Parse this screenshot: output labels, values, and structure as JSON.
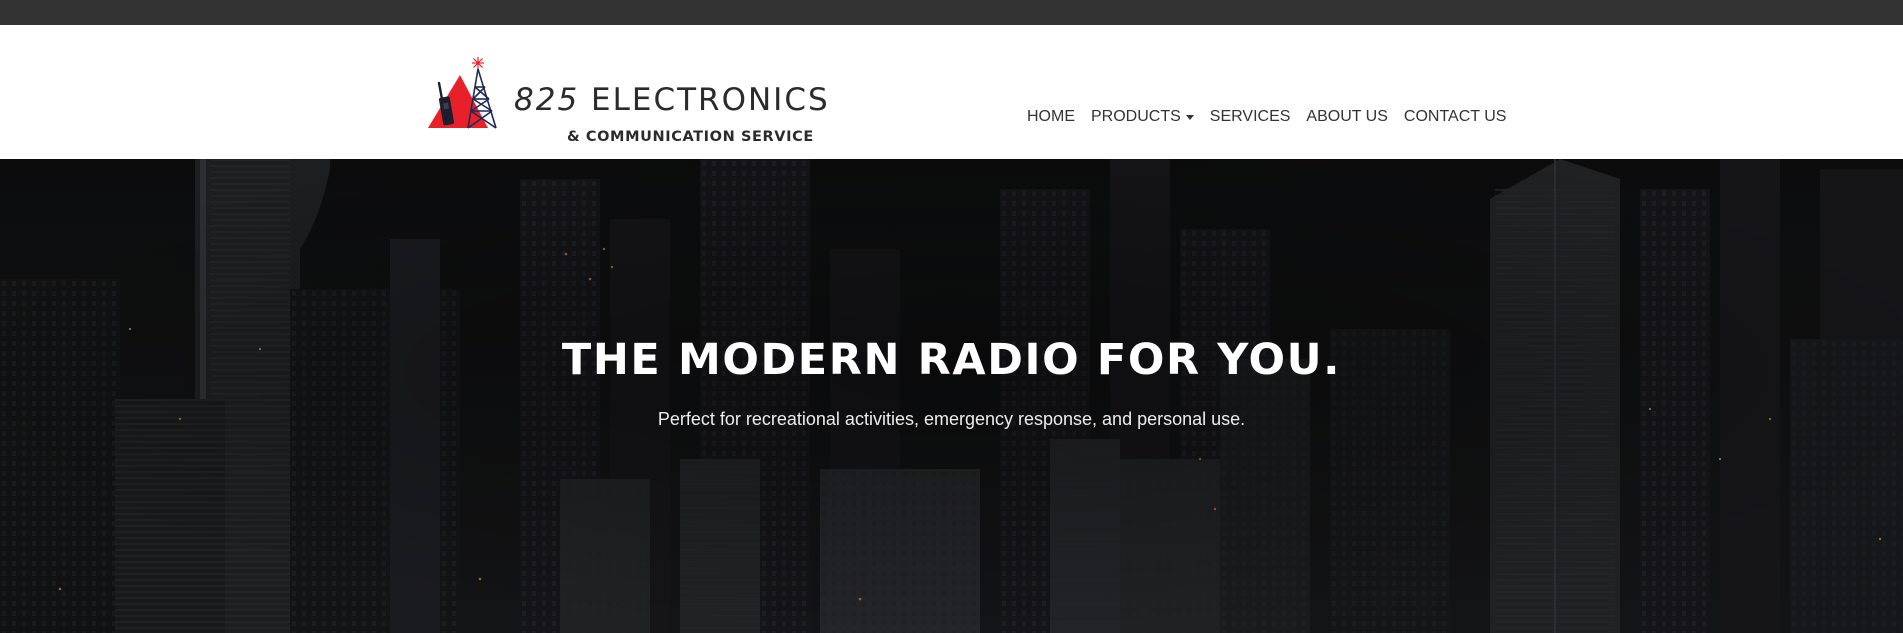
{
  "brand": {
    "number": "825",
    "word": "ELECTRONICS",
    "tagline": "& COMMUNICATION SERVICE"
  },
  "nav": {
    "items": [
      {
        "label": "HOME"
      },
      {
        "label": "PRODUCTS",
        "has_dropdown": true
      },
      {
        "label": "SERVICES"
      },
      {
        "label": "ABOUT US"
      },
      {
        "label": "CONTACT US"
      }
    ]
  },
  "hero": {
    "title": "THE MODERN RADIO FOR YOU.",
    "subtitle": "Perfect for recreational activities, emergency response, and personal use."
  },
  "colors": {
    "top_strip": "#333333",
    "header_bg": "#ffffff",
    "brand_red": "#e8202a",
    "tower_navy": "#1f2a56",
    "text_dark": "#2b2b2b",
    "hero_bg": "#141516"
  }
}
